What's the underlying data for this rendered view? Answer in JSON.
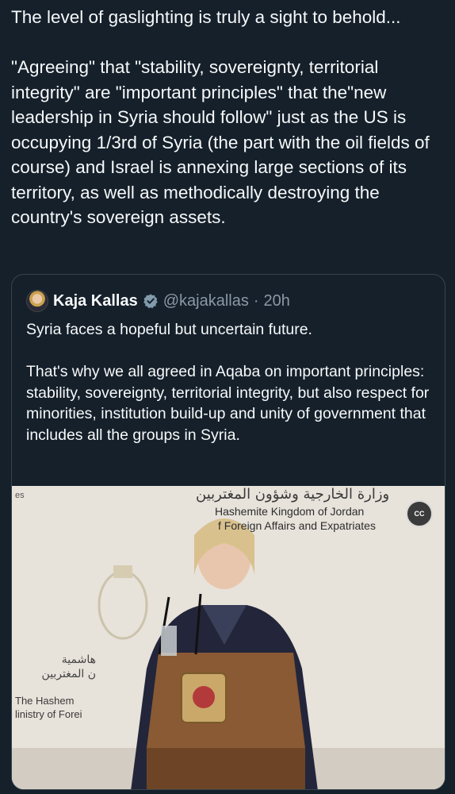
{
  "post": {
    "text": "The level of gaslighting is truly a sight to behold...\n\n\"Agreeing\" that \"stability, sovereignty, territorial integrity\" are \"important principles\" that the\"new leadership in Syria should follow\" just as the US is occupying 1/3rd of Syria (the part with the oil fields of course) and Israel is annexing large sections of its territory, as well as methodically destroying the country's sovereign assets."
  },
  "quote": {
    "author_name": "Kaja Kallas",
    "handle": "@kajakallas",
    "separator": "·",
    "time": "20h",
    "text": "Syria faces a hopeful but uncertain future.\n\nThat's why we all agreed in Aqaba on important principles: stability, sovereignty, territorial integrity, but also respect for minorities, institution build-up and unity of government that includes all the groups in Syria."
  },
  "media": {
    "banner_arabic": "وزارة الخارجية وشؤون المغتربين",
    "banner_en_line1": "Hashemite Kingdom of Jordan",
    "banner_en_line2": "f Foreign Affairs and Expatriates",
    "left_partial_top": "es",
    "left_arabic_line1": "هاشمية",
    "left_arabic_line2": "ن المغتربين",
    "left_en_line1": "The Hashem",
    "left_en_line2": "linistry of Forei",
    "cc_label": "CC"
  },
  "colors": {
    "background": "#15202b",
    "text": "#f7f9f9",
    "muted": "#8b98a5",
    "border": "#38444d",
    "verified_badge": "#829aab"
  },
  "icons": {
    "verified": "verified-badge-icon",
    "captions": "closed-captions-icon"
  }
}
